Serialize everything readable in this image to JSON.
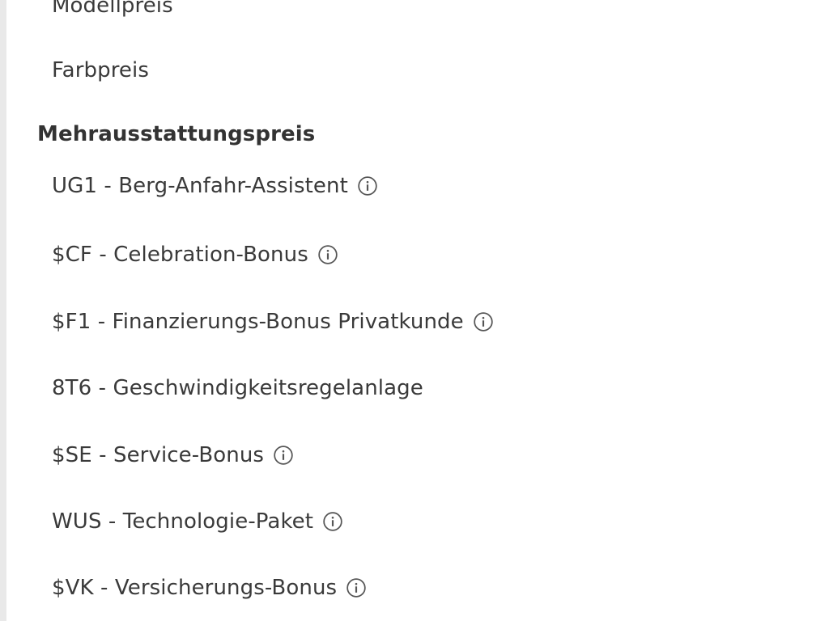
{
  "price_list": {
    "base_items": [
      {
        "label": "Modellpreis"
      },
      {
        "label": "Farbpreis"
      }
    ],
    "section_heading": "Mehrausstattungspreis",
    "extras": [
      {
        "label": "UG1 - Berg-Anfahr-Assistent",
        "info_icon": "info-circle-icon"
      },
      {
        "label": "$CF - Celebration-Bonus",
        "info_icon": "info-circle-icon"
      },
      {
        "label": "$F1 - Finanzierungs-Bonus Privatkunde",
        "info_icon": "info-circle-icon"
      },
      {
        "label": "8T6 - Geschwindigkeitsregelanlage"
      },
      {
        "label": "$SE - Service-Bonus",
        "info_icon": "info-circle-icon"
      },
      {
        "label": "WUS - Technologie-Paket",
        "info_icon": "info-circle-icon"
      },
      {
        "label": "$VK - Versicherungs-Bonus",
        "info_icon": "info-circle-icon"
      }
    ]
  },
  "colors": {
    "text": "#3a3a3a",
    "heading": "#333333",
    "border": "#e9e9e9",
    "icon": "#555555"
  }
}
